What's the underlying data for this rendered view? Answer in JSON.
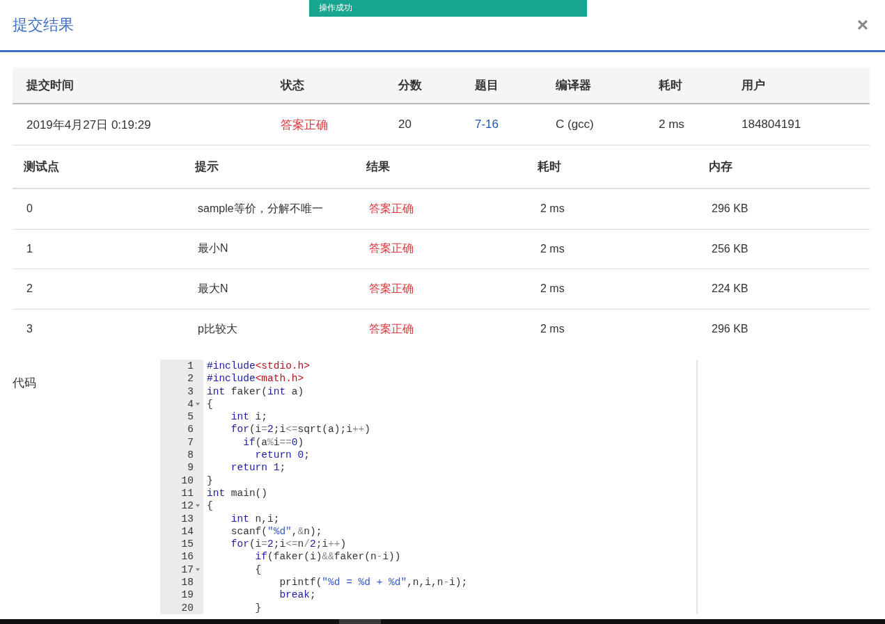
{
  "toast": {
    "text": "操作成功"
  },
  "dialog": {
    "title": "提交结果",
    "close": "×"
  },
  "summary": {
    "columns": [
      "提交时间",
      "状态",
      "分数",
      "题目",
      "编译器",
      "耗时",
      "用户"
    ],
    "row": {
      "time": "2019年4月27日 0:19:29",
      "status": "答案正确",
      "score": "20",
      "problem": "7-16",
      "compiler": "C (gcc)",
      "elapsed": "2 ms",
      "user": "184804191"
    }
  },
  "testcases": {
    "columns": [
      "测试点",
      "提示",
      "结果",
      "耗时",
      "内存"
    ],
    "rows": [
      {
        "id": "0",
        "hint": "sample等价，分解不唯一",
        "result": "答案正确",
        "elapsed": "2 ms",
        "memory": "296 KB"
      },
      {
        "id": "1",
        "hint": "最小N",
        "result": "答案正确",
        "elapsed": "2 ms",
        "memory": "256 KB"
      },
      {
        "id": "2",
        "hint": "最大N",
        "result": "答案正确",
        "elapsed": "2 ms",
        "memory": "224 KB"
      },
      {
        "id": "3",
        "hint": "p比较大",
        "result": "答案正确",
        "elapsed": "2 ms",
        "memory": "296 KB"
      }
    ]
  },
  "code": {
    "label": "代码",
    "lines": [
      {
        "number": "1",
        "foldable": false,
        "tokens": [
          {
            "text": "#include",
            "kind": "keyword"
          },
          {
            "text": "<stdio.h>",
            "kind": "include"
          }
        ]
      },
      {
        "number": "2",
        "foldable": false,
        "tokens": [
          {
            "text": "#include",
            "kind": "keyword"
          },
          {
            "text": "<math.h>",
            "kind": "include"
          }
        ]
      },
      {
        "number": "3",
        "foldable": false,
        "tokens": [
          {
            "text": "int",
            "kind": "keyword"
          },
          {
            "text": " faker(",
            "kind": "plain"
          },
          {
            "text": "int",
            "kind": "keyword"
          },
          {
            "text": " a)",
            "kind": "plain"
          }
        ]
      },
      {
        "number": "4",
        "foldable": true,
        "tokens": [
          {
            "text": "{",
            "kind": "plain"
          }
        ]
      },
      {
        "number": "5",
        "foldable": false,
        "tokens": [
          {
            "text": "    int",
            "kind": "keyword"
          },
          {
            "text": " i;",
            "kind": "plain"
          }
        ]
      },
      {
        "number": "6",
        "foldable": false,
        "tokens": [
          {
            "text": "    for",
            "kind": "keyword"
          },
          {
            "text": "(i",
            "kind": "plain"
          },
          {
            "text": "=",
            "kind": "operator"
          },
          {
            "text": "2",
            "kind": "number"
          },
          {
            "text": ";i",
            "kind": "plain"
          },
          {
            "text": "<=",
            "kind": "operator"
          },
          {
            "text": "sqrt(a);i",
            "kind": "plain"
          },
          {
            "text": "++",
            "kind": "operator"
          },
          {
            "text": ")",
            "kind": "plain"
          }
        ]
      },
      {
        "number": "7",
        "foldable": false,
        "tokens": [
          {
            "text": "      if",
            "kind": "keyword"
          },
          {
            "text": "(a",
            "kind": "plain"
          },
          {
            "text": "%",
            "kind": "operator"
          },
          {
            "text": "i",
            "kind": "plain"
          },
          {
            "text": "==",
            "kind": "operator"
          },
          {
            "text": "0",
            "kind": "number"
          },
          {
            "text": ")",
            "kind": "plain"
          }
        ]
      },
      {
        "number": "8",
        "foldable": false,
        "tokens": [
          {
            "text": "        return",
            "kind": "keyword"
          },
          {
            "text": " 0",
            "kind": "number"
          },
          {
            "text": ";",
            "kind": "plain"
          }
        ]
      },
      {
        "number": "9",
        "foldable": false,
        "tokens": [
          {
            "text": "    return",
            "kind": "keyword"
          },
          {
            "text": " 1",
            "kind": "number"
          },
          {
            "text": ";",
            "kind": "plain"
          }
        ]
      },
      {
        "number": "10",
        "foldable": false,
        "tokens": [
          {
            "text": "}",
            "kind": "plain"
          }
        ]
      },
      {
        "number": "11",
        "foldable": false,
        "tokens": [
          {
            "text": "int",
            "kind": "keyword"
          },
          {
            "text": " main()",
            "kind": "plain"
          }
        ]
      },
      {
        "number": "12",
        "foldable": true,
        "tokens": [
          {
            "text": "{",
            "kind": "plain"
          }
        ]
      },
      {
        "number": "13",
        "foldable": false,
        "tokens": [
          {
            "text": "    int",
            "kind": "keyword"
          },
          {
            "text": " n,i;",
            "kind": "plain"
          }
        ]
      },
      {
        "number": "14",
        "foldable": false,
        "tokens": [
          {
            "text": "    scanf(",
            "kind": "plain"
          },
          {
            "text": "\"%d\"",
            "kind": "string"
          },
          {
            "text": ",",
            "kind": "plain"
          },
          {
            "text": "&",
            "kind": "operator"
          },
          {
            "text": "n);",
            "kind": "plain"
          }
        ]
      },
      {
        "number": "15",
        "foldable": false,
        "tokens": [
          {
            "text": "    for",
            "kind": "keyword"
          },
          {
            "text": "(i",
            "kind": "plain"
          },
          {
            "text": "=",
            "kind": "operator"
          },
          {
            "text": "2",
            "kind": "number"
          },
          {
            "text": ";i",
            "kind": "plain"
          },
          {
            "text": "<=",
            "kind": "operator"
          },
          {
            "text": "n",
            "kind": "plain"
          },
          {
            "text": "/",
            "kind": "operator"
          },
          {
            "text": "2",
            "kind": "number"
          },
          {
            "text": ";i",
            "kind": "plain"
          },
          {
            "text": "++",
            "kind": "operator"
          },
          {
            "text": ")",
            "kind": "plain"
          }
        ]
      },
      {
        "number": "16",
        "foldable": false,
        "tokens": [
          {
            "text": "        if",
            "kind": "keyword"
          },
          {
            "text": "(faker(i)",
            "kind": "plain"
          },
          {
            "text": "&&",
            "kind": "operator"
          },
          {
            "text": "faker(n",
            "kind": "plain"
          },
          {
            "text": "-",
            "kind": "operator"
          },
          {
            "text": "i))",
            "kind": "plain"
          }
        ]
      },
      {
        "number": "17",
        "foldable": true,
        "tokens": [
          {
            "text": "        {",
            "kind": "plain"
          }
        ]
      },
      {
        "number": "18",
        "foldable": false,
        "tokens": [
          {
            "text": "            printf(",
            "kind": "plain"
          },
          {
            "text": "\"%d = %d + %d\"",
            "kind": "string"
          },
          {
            "text": ",n,i,n",
            "kind": "plain"
          },
          {
            "text": "-",
            "kind": "operator"
          },
          {
            "text": "i);",
            "kind": "plain"
          }
        ]
      },
      {
        "number": "19",
        "foldable": false,
        "tokens": [
          {
            "text": "            break",
            "kind": "keyword"
          },
          {
            "text": ";",
            "kind": "plain"
          }
        ]
      },
      {
        "number": "20",
        "foldable": false,
        "tokens": [
          {
            "text": "        }",
            "kind": "plain"
          }
        ]
      }
    ]
  }
}
